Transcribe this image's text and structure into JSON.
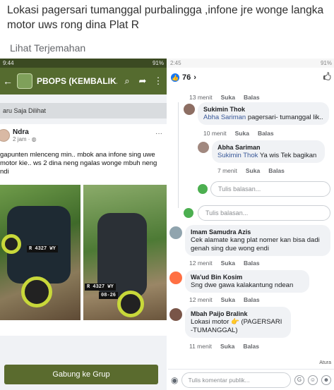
{
  "post": {
    "text": "Lokasi pagersari tumanggal purbalingga ,infone jre wonge langka motor uws rong dina Plat R",
    "translate_label": "Lihat Terjemahan"
  },
  "left_screenshot": {
    "status_time": "9:44",
    "status_right": "91%",
    "app_title": "PBOPS (KEMBALIK...",
    "baru_label": "aru Saja Dilihat",
    "author": "Ndra",
    "post_meta": "2 jam · ",
    "body": "gapunten mlenceng min.. mbok ana infone sing uwe motor kie.. ws 2 dina neng ngalas wonge mbuh neng ndi",
    "plate_1": "R 4327 WY",
    "plate_2": "R 4327 WY",
    "plate_2_sub": "08-26",
    "join_button": "Gabung ke Grup"
  },
  "right_screenshot": {
    "status_time": "2:45",
    "status_right": "91%",
    "reaction_count": "76",
    "action_reply": "Balas",
    "action_like": "Suka",
    "comments": [
      {
        "meta": "13 menit"
      },
      {
        "name": "Sukimin Thok",
        "mention": "Abha Sariman",
        "text": " pagersari- tumanggal lik..",
        "meta": "10 menit"
      },
      {
        "name": "Abha Sariman",
        "mention": "Sukimin Thok",
        "text": " Ya wis Tek bagikan",
        "meta": "7 menit"
      },
      {
        "reply_placeholder": "Tulis balasan..."
      },
      {
        "reply_placeholder": "Tulis balasan..."
      },
      {
        "name": "Imam Samudra Azis",
        "text": "Cek alamate kang plat nomer kan bisa dadi genah sing due wong endi",
        "meta": "12 menit"
      },
      {
        "name": "Wa'ud Bin Kosim",
        "text": "Sng dwe gawa kalakantung ndean",
        "meta": "12 menit"
      },
      {
        "name": "Mbah Paijo Bralink",
        "text": "Lokasi motor 👉 (PAGERSARI -TUMANGGAL)",
        "meta": "11 menit"
      }
    ],
    "atura_label": "Atura",
    "comment_placeholder": "Tulis komentar publik..."
  }
}
